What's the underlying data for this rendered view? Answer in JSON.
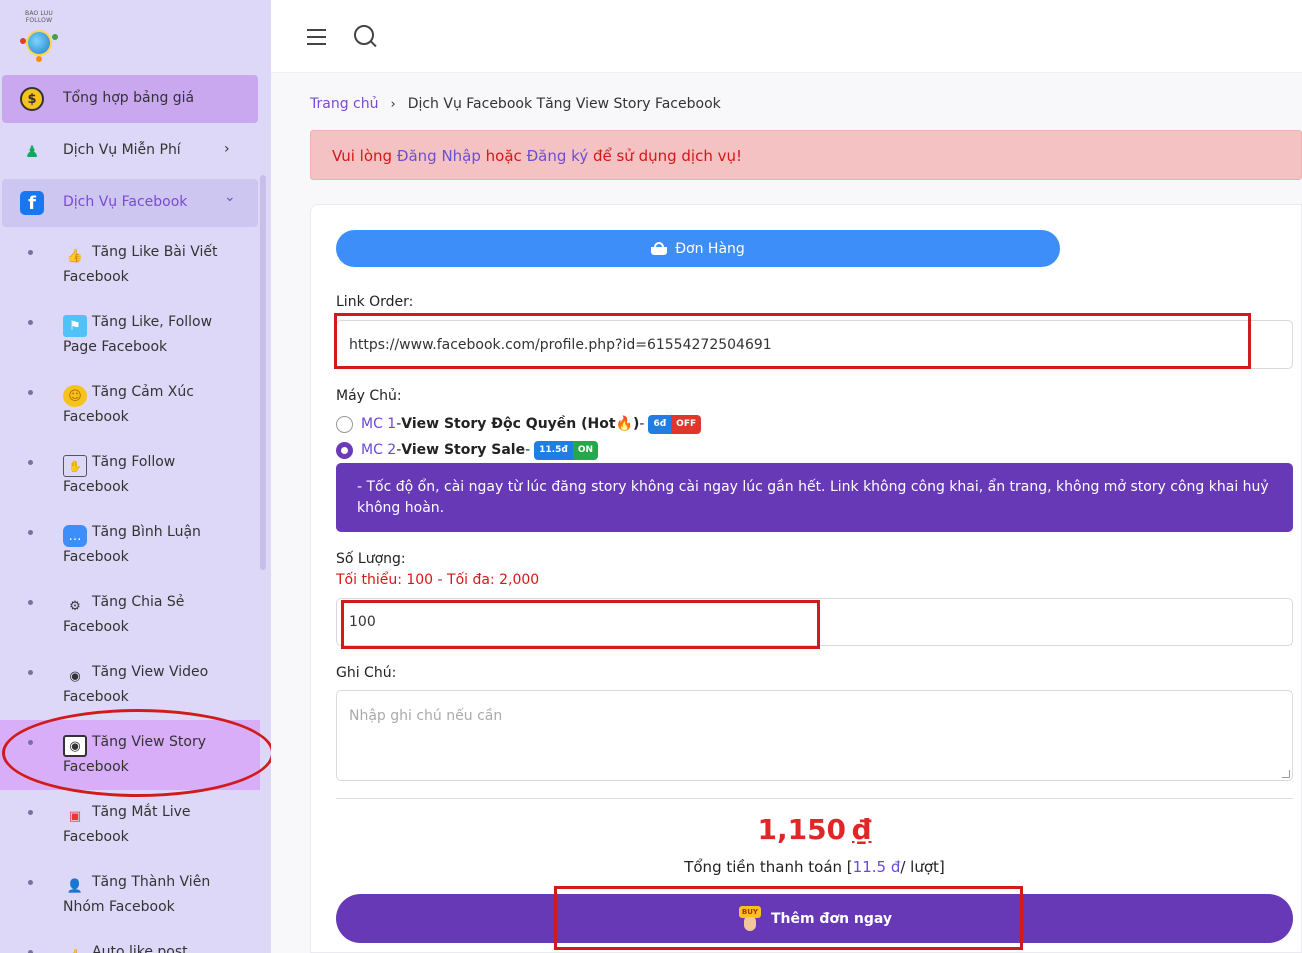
{
  "logo": {
    "text": "BAO LUU FOLLOW"
  },
  "sidebar": {
    "menu": [
      {
        "label": "Tổng hợp bảng giá",
        "icon": "dollar-coin-icon",
        "icon_glyph": "$"
      },
      {
        "label": "Dịch Vụ Miễn Phí",
        "icon": "mascot-icon",
        "icon_glyph": "♟",
        "arrow": "›"
      },
      {
        "label": "Dịch Vụ Facebook",
        "icon": "facebook-icon",
        "icon_glyph": "f",
        "arrow": "⌄"
      }
    ],
    "sub_items": [
      {
        "line1": "Tăng Like Bài Viết",
        "line2": "Facebook",
        "icon": "like-hand-icon",
        "glyph": "👍"
      },
      {
        "line1": "Tăng Like, Follow",
        "line2": "Page Facebook",
        "icon": "page-flag-icon",
        "glyph": "⚑"
      },
      {
        "line1": "Tăng Cảm Xúc",
        "line2": "Facebook",
        "icon": "emoji-smile-icon",
        "glyph": "☺"
      },
      {
        "line1": "Tăng Follow",
        "line2": "Facebook",
        "icon": "follow-click-icon",
        "glyph": "✋"
      },
      {
        "line1": "Tăng Bình Luận",
        "line2": "Facebook",
        "icon": "comment-bubble-icon",
        "glyph": "…"
      },
      {
        "line1": "Tăng Chia Sẻ",
        "line2": "Facebook",
        "icon": "share-nodes-icon",
        "glyph": "⚙"
      },
      {
        "line1": "Tăng View Video",
        "line2": "Facebook",
        "icon": "eye-video-icon",
        "glyph": "◉"
      },
      {
        "line1": "Tăng View Story",
        "line2": "Facebook",
        "icon": "eye-story-icon",
        "glyph": "◉"
      },
      {
        "line1": "Tăng Mắt Live",
        "line2": "Facebook",
        "icon": "live-window-icon",
        "glyph": "▣"
      },
      {
        "line1": "Tăng Thành Viên",
        "line2": "Nhóm Facebook",
        "icon": "member-user-icon",
        "glyph": "👤"
      },
      {
        "line1": "Auto like post",
        "line2": "",
        "icon": "auto-like-icon",
        "glyph": "👍"
      }
    ]
  },
  "breadcrumb": {
    "home": "Trang chủ",
    "separator": "›",
    "current": "Dịch Vụ Facebook Tăng View Story Facebook"
  },
  "alert": {
    "prefix": "Vui lòng ",
    "login": "Đăng Nhập",
    "middle": " hoặc ",
    "register": "Đăng ký",
    "suffix": " để sử dụng dịch vụ!"
  },
  "form": {
    "order_button": "Đơn Hàng",
    "link_label": "Link Order:",
    "link_value": "https://www.facebook.com/profile.php?id=61554272504691",
    "server_label": "Máy Chủ:",
    "servers": [
      {
        "code": "MC 1",
        "sep": " - ",
        "name": "View Story Độc Quyền (Hot🔥)",
        "tail": " - ",
        "badge_left": "6đ",
        "badge_right": "OFF",
        "checked": false
      },
      {
        "code": "MC 2",
        "sep": " - ",
        "name": "View Story Sale",
        "tail": " - ",
        "badge_left": "11.5đ",
        "badge_right": "ON",
        "checked": true
      }
    ],
    "description": "- Tốc độ ổn, cài ngay từ lúc đăng story không cài ngay lúc gần hết. Link không công khai, ẩn trang, không mở story công khai huỷ không hoàn.",
    "quantity_label": "Số Lượng:",
    "quantity_limits": "Tối thiểu: 100 - Tối đa: 2,000",
    "quantity_value": "100",
    "note_label": "Ghi Chú:",
    "note_placeholder": "Nhập ghi chú nếu cần",
    "price_amount": "1,150",
    "price_currency": "₫",
    "total_prefix": "Tổng tiền thanh toán [",
    "total_unit": "11.5 đ",
    "total_suffix": "/ lượt]",
    "submit_label": "Thêm đơn ngay",
    "buy_tag": "BUY"
  },
  "colors": {
    "sidebar_bg": "#ded8f8",
    "accent_purple": "#6739b7",
    "order_blue": "#3d8ef8",
    "alert_red": "#d41717",
    "annotation_red": "#d11b1b"
  }
}
